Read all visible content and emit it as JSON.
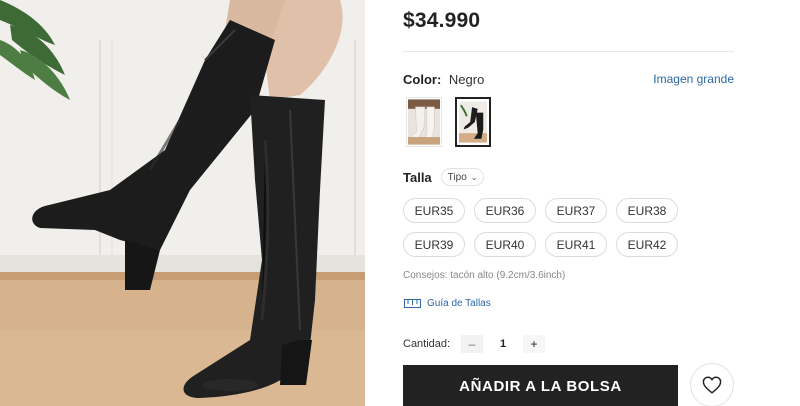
{
  "product": {
    "price": "$34.990",
    "image_alt": "product-photo-black-knee-high-boots"
  },
  "color": {
    "label": "Color:",
    "value": "Negro",
    "big_image_link": "Imagen grande",
    "swatches": [
      {
        "name": "beige-boots-swatch",
        "selected": false
      },
      {
        "name": "black-boots-swatch",
        "selected": true
      }
    ]
  },
  "size": {
    "label": "Talla",
    "type_select": "Tipo",
    "options": [
      "EUR35",
      "EUR36",
      "EUR37",
      "EUR38",
      "EUR39",
      "EUR40",
      "EUR41",
      "EUR42"
    ],
    "tip": "Consejos: tacón alto (9.2cm/3.6inch)",
    "guide_link": "Guía de Tallas"
  },
  "quantity": {
    "label": "Cantidad:",
    "minus": "–",
    "value": "1",
    "plus": "+"
  },
  "actions": {
    "add_to_bag": "AÑADIR A LA BOLSA",
    "wishlist_icon": "heart-icon"
  },
  "colors": {
    "text": "#222222",
    "link": "#2d68a8",
    "button_bg": "#222222",
    "button_text": "#ffffff",
    "border": "#dcdcdc"
  }
}
